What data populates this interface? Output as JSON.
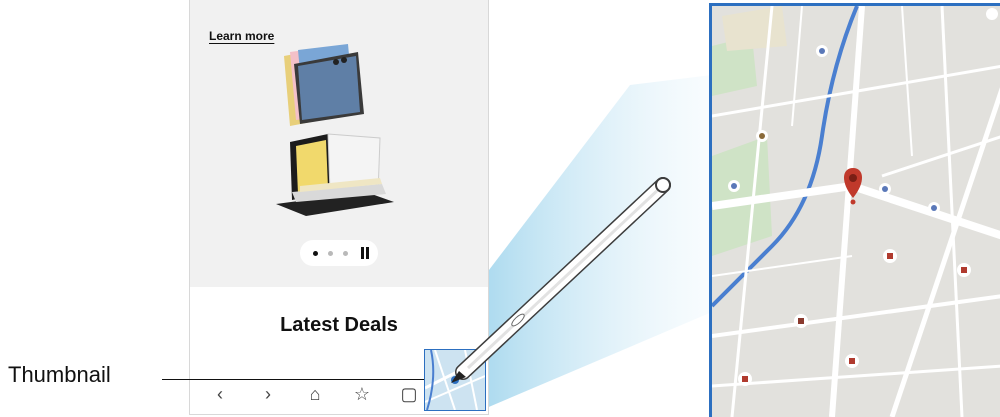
{
  "phone": {
    "learn_more": "Learn more",
    "deals_title": "Latest Deals",
    "nav_icons": [
      "back-icon",
      "forward-icon",
      "home-icon",
      "bookmarks-icon",
      "tabs-icon"
    ],
    "nav_glyphs": [
      "‹",
      "›",
      "⌂",
      "☆",
      "▢"
    ]
  },
  "callout": {
    "label": "Thumbnail"
  },
  "colors": {
    "accent_blue": "#2c6fc0",
    "map_land": "#e2e1dd",
    "map_water": "#4a7fd0",
    "map_park": "#cfe3c6",
    "pin_red": "#c0392b"
  }
}
